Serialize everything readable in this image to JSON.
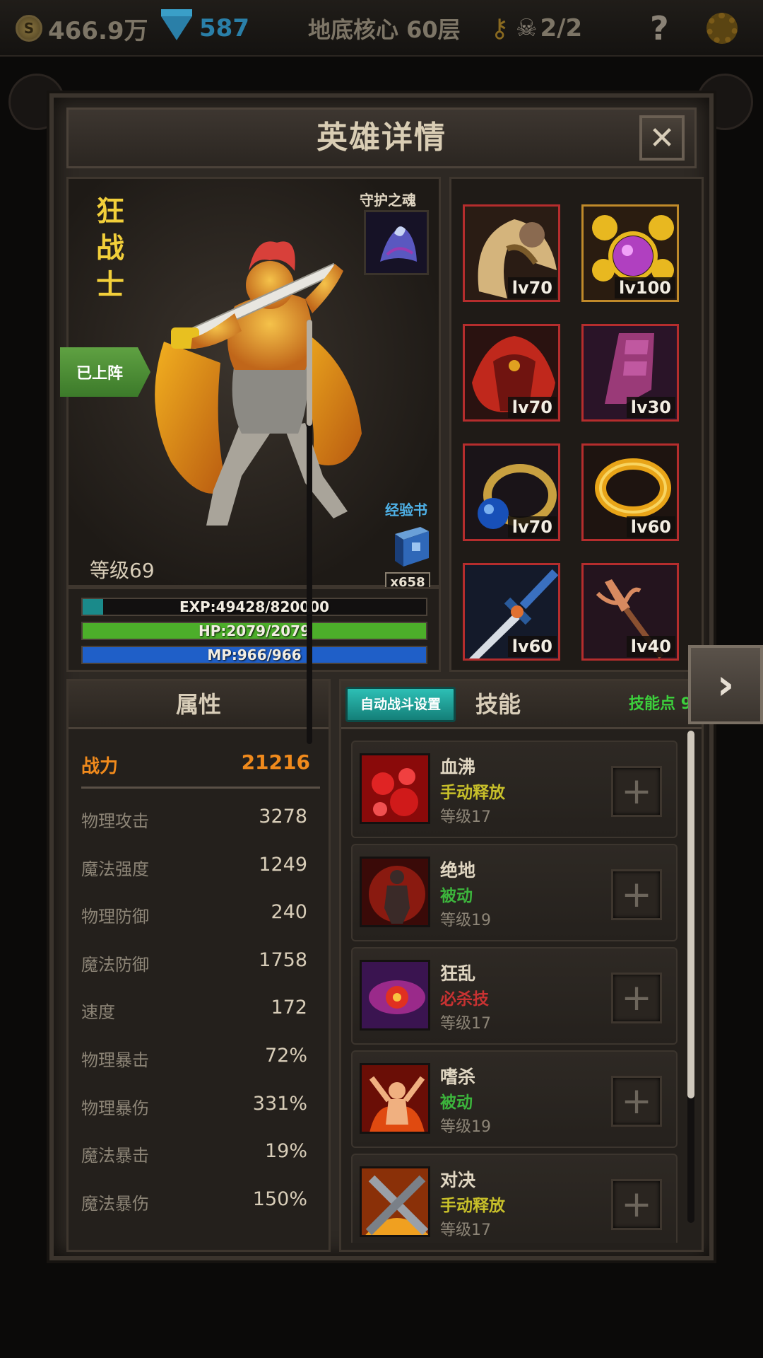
{
  "hud": {
    "gold": "466.9万",
    "gold_icon": "coin-icon",
    "gems": "587",
    "gem_icon": "diamond-icon",
    "location": "地底核心 60层",
    "keys_icon": "key-icon",
    "lives": "2/2",
    "lives_icon": "skull-icon",
    "help": "?",
    "settings_icon": "gear-icon"
  },
  "modal": {
    "title": "英雄详情",
    "close": "✕"
  },
  "hero": {
    "name": "狂战士",
    "guardian_label": "守护之魂",
    "deployed": "已上阵",
    "exp_book_label": "经验书",
    "exp_book_count": "x658",
    "level": "等级69",
    "exp": "EXP:49428/820000",
    "exp_fraction": 0.06,
    "hp": "HP:2079/2079",
    "hp_fraction": 1.0,
    "mp": "MP:966/966",
    "mp_fraction": 1.0
  },
  "equipment": [
    {
      "name": "helmet",
      "level": "lv70",
      "rarity": "red"
    },
    {
      "name": "amulet",
      "level": "lv100",
      "rarity": "gold"
    },
    {
      "name": "cloak",
      "level": "lv70",
      "rarity": "red"
    },
    {
      "name": "boots",
      "level": "lv30",
      "rarity": "red"
    },
    {
      "name": "sapphire-ring",
      "level": "lv70",
      "rarity": "red"
    },
    {
      "name": "gold-ring",
      "level": "lv60",
      "rarity": "red"
    },
    {
      "name": "sword",
      "level": "lv60",
      "rarity": "red"
    },
    {
      "name": "trident",
      "level": "lv40",
      "rarity": "red"
    }
  ],
  "next_arrow": "›",
  "attributes": {
    "header": "属性",
    "power_label": "战力",
    "power_value": "21216",
    "rows": [
      {
        "label": "物理攻击",
        "value": "3278"
      },
      {
        "label": "魔法强度",
        "value": "1249"
      },
      {
        "label": "物理防御",
        "value": "240"
      },
      {
        "label": "魔法防御",
        "value": "1758"
      },
      {
        "label": "速度",
        "value": "172"
      },
      {
        "label": "物理暴击",
        "value": "72%"
      },
      {
        "label": "物理暴伤",
        "value": "331%"
      },
      {
        "label": "魔法暴击",
        "value": "19%"
      },
      {
        "label": "魔法暴伤",
        "value": "150%"
      }
    ]
  },
  "skills": {
    "auto_button": "自动战斗设置",
    "header": "技能",
    "points": "技能点 9",
    "items": [
      {
        "name": "血沸",
        "type": "手动释放",
        "type_color": "#c8c02a",
        "level": "等级17",
        "plus": "+"
      },
      {
        "name": "绝地",
        "type": "被动",
        "type_color": "#3cb43c",
        "level": "等级19",
        "plus": "+"
      },
      {
        "name": "狂乱",
        "type": "必杀技",
        "type_color": "#c83232",
        "level": "等级17",
        "plus": "+"
      },
      {
        "name": "嗜杀",
        "type": "被动",
        "type_color": "#3cb43c",
        "level": "等级19",
        "plus": "+"
      },
      {
        "name": "对决",
        "type": "手动释放",
        "type_color": "#c8c02a",
        "level": "等级17",
        "plus": "+"
      }
    ]
  },
  "colors": {
    "exp_bar": "#1a8a8a",
    "hp_bar": "#4cae2a",
    "mp_bar": "#1f5fc8",
    "power": "#f08a1c",
    "hero_name": "#f2cf3a"
  }
}
